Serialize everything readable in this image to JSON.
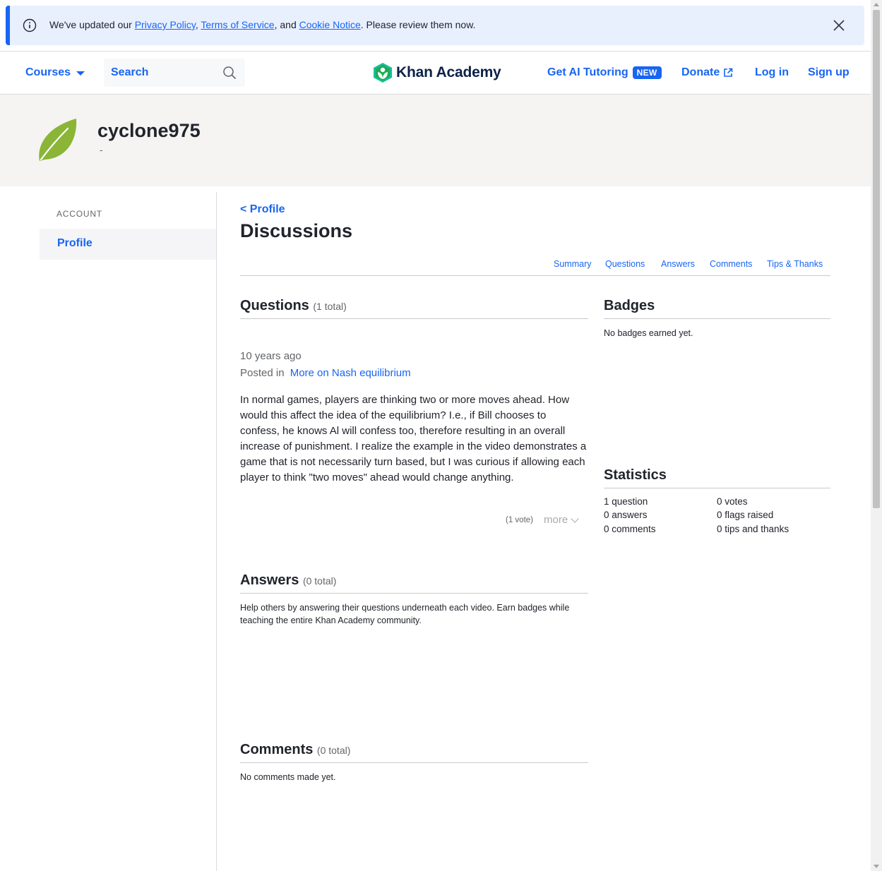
{
  "banner": {
    "prefix": "We've updated our ",
    "privacy": "Privacy Policy",
    "sep1": ", ",
    "terms": "Terms of Service",
    "sep2": ", and ",
    "cookie": "Cookie Notice",
    "suffix": ". Please review them now."
  },
  "header": {
    "courses": "Courses",
    "search": "Search",
    "logo": "Khan Academy",
    "ai_tutoring": "Get AI Tutoring",
    "new_badge": "NEW",
    "donate": "Donate",
    "login": "Log in",
    "signup": "Sign up"
  },
  "profile": {
    "username": "cyclone975",
    "nickname": "-"
  },
  "sidebar": {
    "section": "ACCOUNT",
    "items": [
      {
        "label": "Profile"
      }
    ]
  },
  "main": {
    "back": "< Profile",
    "title": "Discussions",
    "tabs": [
      "Summary",
      "Questions",
      "Answers",
      "Comments",
      "Tips & Thanks"
    ]
  },
  "questions": {
    "title": "Questions",
    "total": "(1 total)",
    "items": [
      {
        "time": "10 years ago",
        "posted_in_label": "Posted in",
        "posted_in": "More on Nash equilibrium",
        "body": "In normal games, players are thinking two or more moves ahead. How would this affect the idea of the equilibrium? I.e., if Bill chooses to confess, he knows Al will confess too, therefore resulting in an overall increase of punishment. I realize the example in the video demonstrates a game that is not necessarily turn based, but I was curious if allowing each player to think \"two moves\" ahead would change anything.",
        "votes": "(1 vote)",
        "more": "more"
      }
    ]
  },
  "answers": {
    "title": "Answers",
    "total": "(0 total)",
    "empty": "Help others by answering their questions underneath each video. Earn badges while teaching the entire Khan Academy community."
  },
  "comments": {
    "title": "Comments",
    "total": "(0 total)",
    "empty": "No comments made yet."
  },
  "badges": {
    "title": "Badges",
    "empty": "No badges earned yet."
  },
  "statistics": {
    "title": "Statistics",
    "left": [
      "1 question",
      "0 answers",
      "0 comments"
    ],
    "right": [
      "0 votes",
      "0 flags raised",
      "0 tips and thanks"
    ]
  },
  "colors": {
    "accent": "#1865f2",
    "logo_green": "#1fab54",
    "leaf_green": "#8ab536",
    "banner_bg": "#e8f0fe",
    "profile_band": "#f5f4f2"
  }
}
